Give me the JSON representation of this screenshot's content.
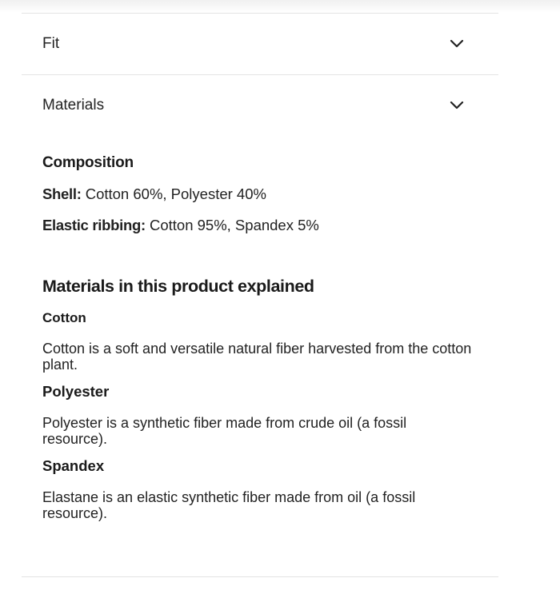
{
  "accordion": {
    "fit": {
      "title": "Fit"
    },
    "materials": {
      "title": "Materials",
      "composition_title": "Composition",
      "composition": [
        {
          "label": "Shell:",
          "value": " Cotton 60%, Polyester 40%"
        },
        {
          "label": "Elastic ribbing:",
          "value": " Cotton 95%, Spandex 5%"
        }
      ],
      "explained_title": "Materials in this product explained",
      "items": [
        {
          "name": "Cotton",
          "description": "Cotton is a soft and versatile natural fiber harvested from the cotton plant."
        },
        {
          "name": "Polyester",
          "description": "Polyester is a synthetic fiber made from crude oil (a fossil resource)."
        },
        {
          "name": "Spandex",
          "description": "Elastane is an elastic synthetic fiber made from oil (a fossil resource)."
        }
      ]
    }
  },
  "icons": {
    "expand": "chevron-down-icon"
  },
  "colors": {
    "text": "#1a1a1a",
    "divider": "#e3e3e3",
    "background": "#ffffff"
  }
}
